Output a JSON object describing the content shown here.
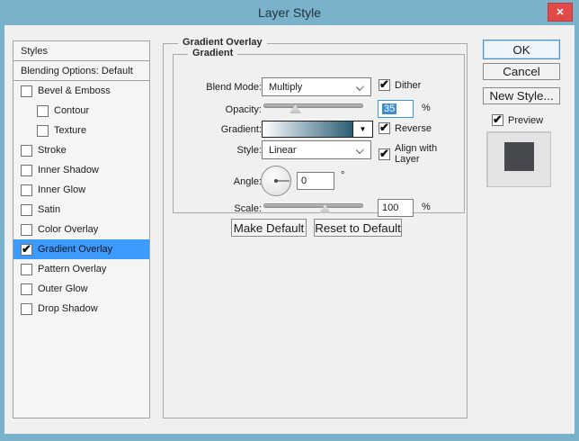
{
  "window": {
    "title": "Layer Style",
    "close_glyph": "✕"
  },
  "colors": {
    "titlebar": "#79b2ca",
    "close_button": "#e04a49",
    "selection": "#3d9bfd",
    "panel_bg": "#f0f0f0",
    "gradient_start": "#ffffff",
    "gradient_end": "#2d5e74",
    "preview_swatch": "#45494d"
  },
  "sidebar": {
    "items": [
      {
        "label": "Styles",
        "type": "plain",
        "header": true
      },
      {
        "label": "Blending Options: Default",
        "type": "plain",
        "header": true
      },
      {
        "label": "Bevel & Emboss",
        "checkbox": true,
        "checked": false
      },
      {
        "label": "Contour",
        "checkbox": true,
        "checked": false,
        "indent": true
      },
      {
        "label": "Texture",
        "checkbox": true,
        "checked": false,
        "indent": true
      },
      {
        "label": "Stroke",
        "checkbox": true,
        "checked": false
      },
      {
        "label": "Inner Shadow",
        "checkbox": true,
        "checked": false
      },
      {
        "label": "Inner Glow",
        "checkbox": true,
        "checked": false
      },
      {
        "label": "Satin",
        "checkbox": true,
        "checked": false
      },
      {
        "label": "Color Overlay",
        "checkbox": true,
        "checked": false
      },
      {
        "label": "Gradient Overlay",
        "checkbox": true,
        "checked": true,
        "selected": true
      },
      {
        "label": "Pattern Overlay",
        "checkbox": true,
        "checked": false
      },
      {
        "label": "Outer Glow",
        "checkbox": true,
        "checked": false
      },
      {
        "label": "Drop Shadow",
        "checkbox": true,
        "checked": false
      }
    ]
  },
  "panel": {
    "group_title": "Gradient Overlay",
    "subgroup_title": "Gradient",
    "blend_mode": {
      "label": "Blend Mode:",
      "value": "Multiply"
    },
    "dither": {
      "label": "Dither",
      "checked": true
    },
    "opacity": {
      "label": "Opacity:",
      "value": "35",
      "unit": "%",
      "percent": 35
    },
    "gradient": {
      "label": "Gradient:",
      "reverse_label": "Reverse",
      "reverse_checked": true
    },
    "style": {
      "label": "Style:",
      "value": "Linear"
    },
    "align": {
      "label": "Align with Layer",
      "checked": true
    },
    "angle": {
      "label": "Angle:",
      "value": "0",
      "unit": "°"
    },
    "scale": {
      "label": "Scale:",
      "value": "100",
      "unit": "%",
      "percent": 62
    },
    "buttons": {
      "make_default": "Make Default",
      "reset_default": "Reset to Default"
    },
    "gradient_arrow_glyph": "▼"
  },
  "actions": {
    "ok": "OK",
    "cancel": "Cancel",
    "new_style": "New Style...",
    "preview_label": "Preview",
    "preview_checked": true
  }
}
